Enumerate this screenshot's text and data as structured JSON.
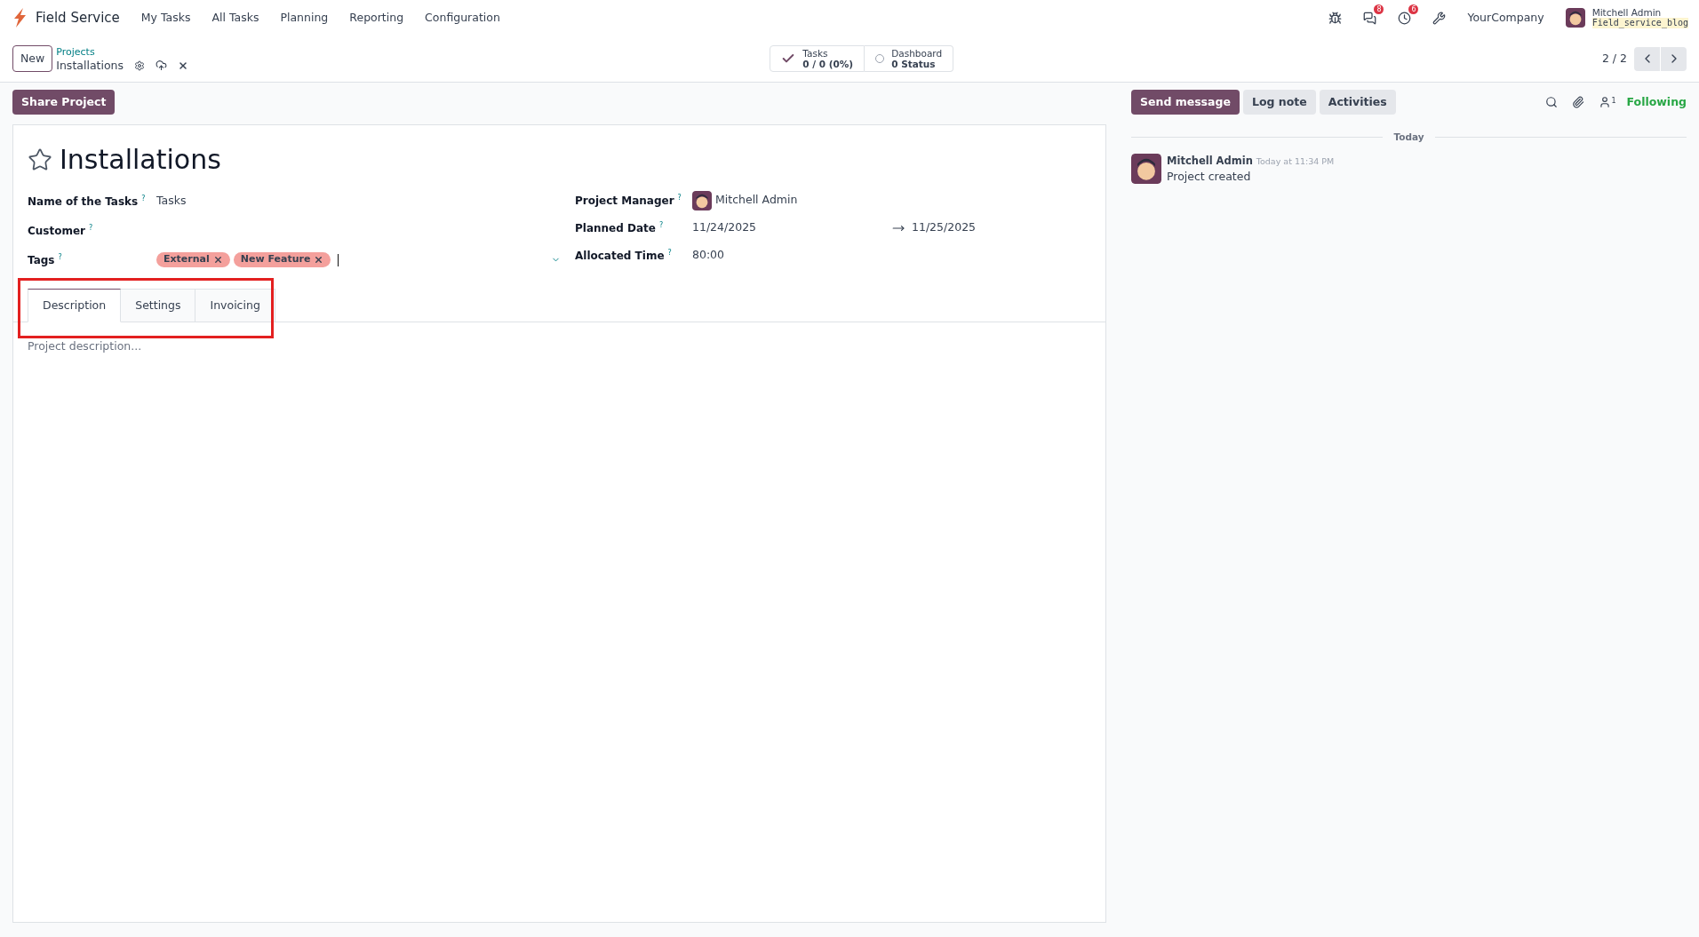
{
  "navbar": {
    "app": "Field Service",
    "menu": [
      "My Tasks",
      "All Tasks",
      "Planning",
      "Reporting",
      "Configuration"
    ],
    "systray": [
      {
        "kind": "bug"
      },
      {
        "kind": "chat",
        "badge": "8"
      },
      {
        "kind": "clock",
        "badge": "6"
      },
      {
        "kind": "tools"
      }
    ],
    "company": "YourCompany",
    "user": "Mitchell Admin",
    "database": "Field_service_blog"
  },
  "control_panel": {
    "new_button": "New",
    "breadcrumb": "Projects",
    "record": "Installations",
    "stat_buttons": [
      {
        "kind": "check",
        "label": "Tasks",
        "value": "0 / 0 (0%)"
      },
      {
        "kind": "dot",
        "label": "Dashboard",
        "value": "0 Status"
      }
    ],
    "pager": "2 / 2"
  },
  "share_button": "Share Project",
  "form": {
    "title": "Installations",
    "favorite": false,
    "left_fields": [
      {
        "label": "Name of the Tasks",
        "help": "?",
        "value": "Tasks"
      },
      {
        "label": "Customer",
        "help": "?"
      },
      {
        "label": "Tags",
        "help": "?",
        "kind": "tags",
        "tags": [
          {
            "name": "External"
          },
          {
            "name": "New Feature"
          }
        ]
      }
    ],
    "right_fields": [
      {
        "label": "Project Manager",
        "help": "?",
        "kind": "user",
        "value": "Mitchell Admin"
      },
      {
        "label": "Planned Date",
        "help": "?",
        "kind": "range",
        "value": "11/24/2025",
        "end": "11/25/2025"
      },
      {
        "label": "Allocated Time",
        "help": "?",
        "value": "80:00"
      }
    ],
    "tabs": [
      {
        "label": "Description",
        "selected": true
      },
      {
        "label": "Settings",
        "selected": false
      },
      {
        "label": "Invoicing",
        "selected": false
      }
    ],
    "tabs_highlighted": true,
    "description": {
      "placeholder": "Project description..."
    }
  },
  "chatter": {
    "buttons": [
      {
        "label": "Send message",
        "selected": true
      },
      {
        "label": "Log note",
        "selected": false
      },
      {
        "label": "Activities",
        "selected": false
      }
    ],
    "followers": "1",
    "following": "Following",
    "separator": "Today",
    "messages": [
      {
        "author": "Mitchell Admin",
        "time": "Today at 11:34 PM",
        "body": "Project created"
      }
    ]
  }
}
